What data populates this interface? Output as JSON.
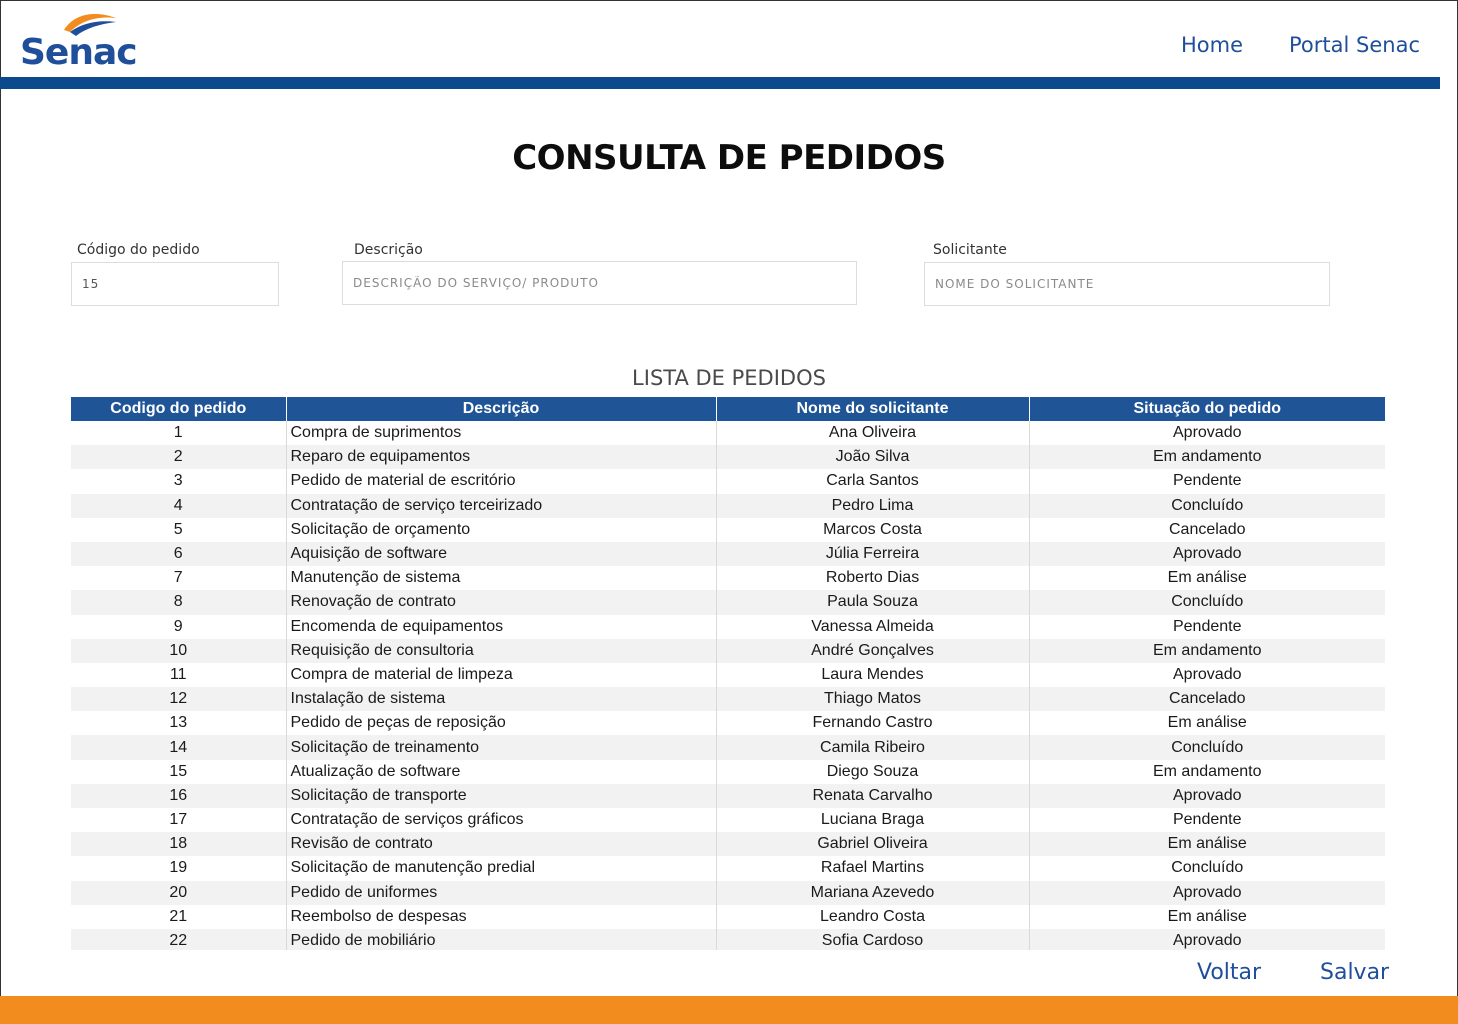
{
  "header": {
    "logo_text": "Senac",
    "nav": [
      {
        "label": "Home"
      },
      {
        "label": "Portal Senac"
      }
    ]
  },
  "page_title": "CONSULTA DE PEDIDOS",
  "filters": {
    "codigo": {
      "label": "Código do pedido",
      "value": "15"
    },
    "descricao": {
      "label": "Descrição",
      "placeholder": "DESCRIÇÃO DO SERVIÇO/ PRODUTO"
    },
    "solicitante": {
      "label": "Solicitante",
      "placeholder": "NOME DO SOLICITANTE"
    }
  },
  "list": {
    "title": "LISTA DE PEDIDOS",
    "columns": [
      "Codigo do pedido",
      "Descrição",
      "Nome do solicitante",
      "Situação do pedido"
    ],
    "rows": [
      {
        "id": "1",
        "desc": "Compra de suprimentos",
        "name": "Ana Oliveira",
        "status": "Aprovado"
      },
      {
        "id": "2",
        "desc": "Reparo de equipamentos",
        "name": "João Silva",
        "status": "Em andamento"
      },
      {
        "id": "3",
        "desc": "Pedido de material de escritório",
        "name": "Carla Santos",
        "status": "Pendente"
      },
      {
        "id": "4",
        "desc": "Contratação de serviço terceirizado",
        "name": "Pedro Lima",
        "status": "Concluído"
      },
      {
        "id": "5",
        "desc": "Solicitação de orçamento",
        "name": "Marcos Costa",
        "status": "Cancelado"
      },
      {
        "id": "6",
        "desc": "Aquisição de software",
        "name": "Júlia Ferreira",
        "status": "Aprovado"
      },
      {
        "id": "7",
        "desc": "Manutenção de sistema",
        "name": "Roberto Dias",
        "status": "Em análise"
      },
      {
        "id": "8",
        "desc": "Renovação de contrato",
        "name": "Paula Souza",
        "status": "Concluído"
      },
      {
        "id": "9",
        "desc": "Encomenda de equipamentos",
        "name": "Vanessa Almeida",
        "status": "Pendente"
      },
      {
        "id": "10",
        "desc": "Requisição de consultoria",
        "name": "André Gonçalves",
        "status": "Em andamento"
      },
      {
        "id": "11",
        "desc": "Compra de material de limpeza",
        "name": "Laura Mendes",
        "status": "Aprovado"
      },
      {
        "id": "12",
        "desc": "Instalação de sistema",
        "name": "Thiago Matos",
        "status": "Cancelado"
      },
      {
        "id": "13",
        "desc": "Pedido de peças de reposição",
        "name": "Fernando Castro",
        "status": "Em análise"
      },
      {
        "id": "14",
        "desc": "Solicitação de treinamento",
        "name": "Camila Ribeiro",
        "status": "Concluído"
      },
      {
        "id": "15",
        "desc": "Atualização de software",
        "name": "Diego Souza",
        "status": "Em andamento"
      },
      {
        "id": "16",
        "desc": "Solicitação de transporte",
        "name": "Renata Carvalho",
        "status": "Aprovado"
      },
      {
        "id": "17",
        "desc": "Contratação de serviços gráficos",
        "name": "Luciana Braga",
        "status": "Pendente"
      },
      {
        "id": "18",
        "desc": "Revisão de contrato",
        "name": "Gabriel Oliveira",
        "status": "Em análise"
      },
      {
        "id": "19",
        "desc": "Solicitação de manutenção predial",
        "name": "Rafael Martins",
        "status": "Concluído"
      },
      {
        "id": "20",
        "desc": "Pedido de uniformes",
        "name": "Mariana Azevedo",
        "status": "Aprovado"
      },
      {
        "id": "21",
        "desc": "Reembolso de despesas",
        "name": "Leandro Costa",
        "status": "Em análise"
      },
      {
        "id": "22",
        "desc": "Pedido de mobiliário",
        "name": "Sofia Cardoso",
        "status": "Aprovado"
      }
    ]
  },
  "actions": {
    "voltar": "Voltar",
    "salvar": "Salvar"
  },
  "colors": {
    "primary_blue": "#0b4a8c",
    "header_blue": "#1f5597",
    "link_blue": "#1f4e9a",
    "accent_orange": "#f28c1e"
  }
}
